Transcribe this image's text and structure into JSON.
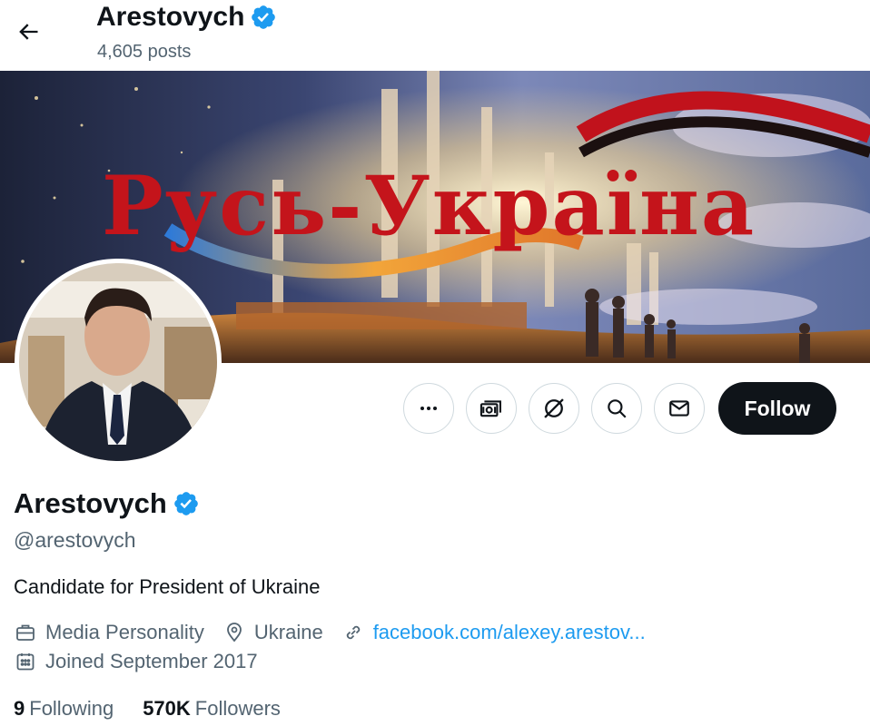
{
  "header": {
    "name": "Arestovych",
    "posts": "4,605 posts"
  },
  "banner": {
    "title_text": "Русь-Україна",
    "colors": {
      "title": "#c4141b",
      "sky": "#33406a",
      "glow": "#ffe7a8"
    }
  },
  "actions": {
    "follow_label": "Follow",
    "icons": [
      "more-icon",
      "subscribe-icon",
      "grok-icon",
      "search-icon",
      "message-icon"
    ]
  },
  "profile": {
    "name": "Arestovych",
    "handle": "@arestovych",
    "bio": "Candidate for President of Ukraine",
    "category": "Media Personality",
    "location": "Ukraine",
    "website": "facebook.com/alexey.arestov...",
    "joined": "Joined September 2017"
  },
  "stats": {
    "following_count": "9",
    "following_label": "Following",
    "followers_count": "570K",
    "followers_label": "Followers"
  },
  "colors": {
    "verified": "#1d9bf0",
    "link": "#1d9bf0",
    "secondary_text": "#536471",
    "follow_bg": "#0f1419"
  }
}
